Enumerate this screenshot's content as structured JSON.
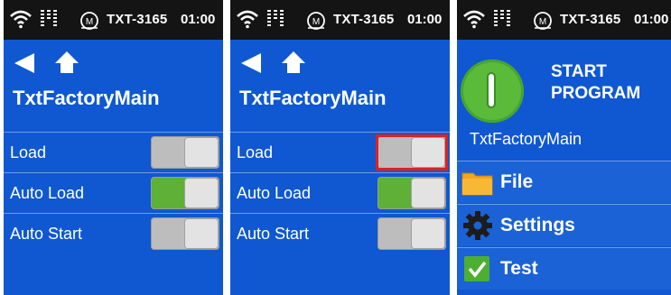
{
  "status": {
    "device": "TXT-3165",
    "time": "01:00"
  },
  "screen": {
    "title": "TxtFactoryMain"
  },
  "settings_rows": [
    {
      "label": "Load",
      "state": "off"
    },
    {
      "label": "Auto Load",
      "state": "on"
    },
    {
      "label": "Auto Start",
      "state": "off"
    }
  ],
  "main_menu": {
    "start_line1": "START",
    "start_line2": "PROGRAM",
    "program_name": "TxtFactoryMain",
    "items": [
      {
        "label": "File",
        "icon": "folder-icon"
      },
      {
        "label": "Settings",
        "icon": "gear-icon"
      },
      {
        "label": "Test",
        "icon": "checkmark-icon"
      }
    ]
  },
  "colors": {
    "background": "#0f58d1",
    "statusbar": "#141414",
    "toggle_on": "#5eb036",
    "highlight": "#e02020"
  }
}
